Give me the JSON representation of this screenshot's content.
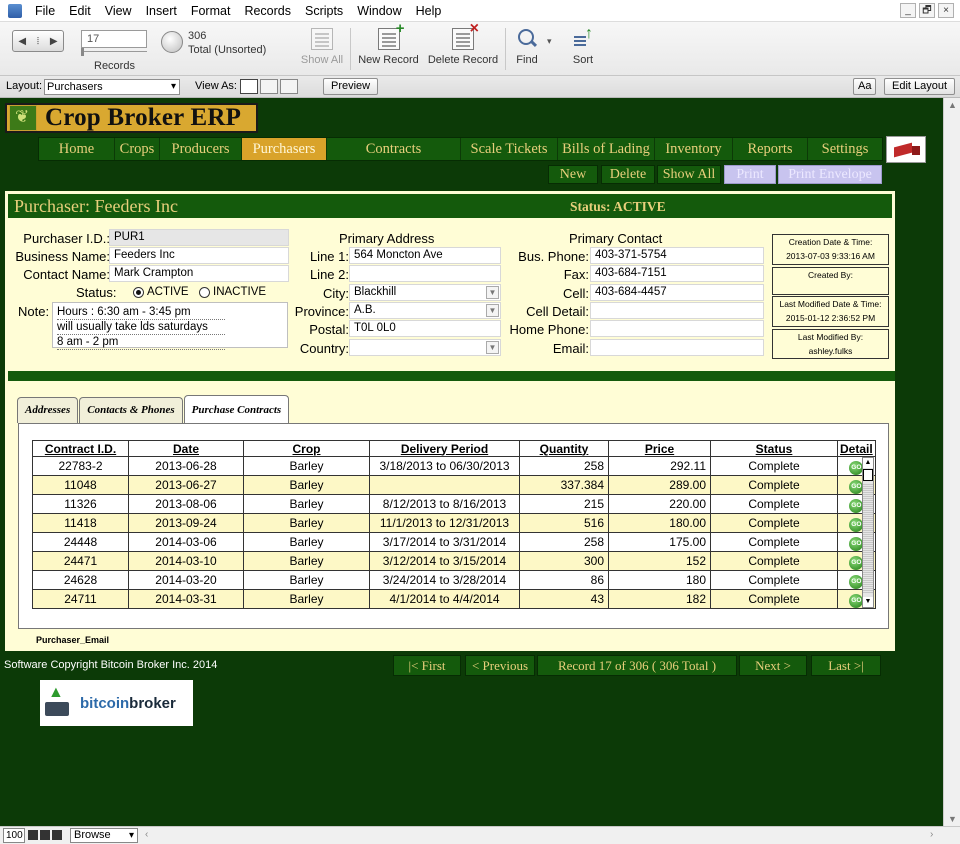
{
  "menu": [
    "File",
    "Edit",
    "View",
    "Insert",
    "Format",
    "Records",
    "Scripts",
    "Window",
    "Help"
  ],
  "window_buttons": [
    "_",
    "🗗",
    "×"
  ],
  "toolbar": {
    "record_value": "17",
    "records_label": "Records",
    "total_count": "306",
    "total_label": "Total (Unsorted)",
    "show_all": "Show All",
    "new_record": "New Record",
    "delete_record": "Delete Record",
    "find": "Find",
    "sort": "Sort"
  },
  "layoutbar": {
    "layout_label": "Layout:",
    "layout_value": "Purchasers",
    "view_as_label": "View As:",
    "preview": "Preview",
    "aa": "Aa",
    "edit_layout": "Edit Layout"
  },
  "app": {
    "title": "Crop Broker ERP"
  },
  "nav": [
    "Home",
    "Crops",
    "Producers",
    "Purchasers",
    "Contracts",
    "Scale Tickets",
    "Bills of Lading",
    "Inventory",
    "Reports",
    "Settings"
  ],
  "nav_active": "Purchasers",
  "actions": {
    "new": "New",
    "delete": "Delete",
    "show_all": "Show All",
    "print": "Print",
    "print_envelope": "Print Envelope"
  },
  "header": {
    "title": "Purchaser: Feeders Inc",
    "status": "Status: ACTIVE"
  },
  "fields": {
    "purchaser_id_label": "Purchaser I.D.:",
    "purchaser_id": "PUR1",
    "business_name_label": "Business Name:",
    "business_name": "Feeders Inc",
    "contact_name_label": "Contact Name:",
    "contact_name": "Mark Crampton",
    "status_label": "Status:",
    "status_active": "ACTIVE",
    "status_inactive": "INACTIVE",
    "note_label": "Note:",
    "note_lines": [
      "Hours : 6:30 am - 3:45 pm",
      "will usually take lds saturdays",
      "8 am - 2 pm"
    ]
  },
  "address": {
    "heading": "Primary Address",
    "line1_label": "Line 1:",
    "line1": "564 Moncton Ave",
    "line2_label": "Line 2:",
    "line2": "",
    "city_label": "City:",
    "city": "Blackhill",
    "province_label": "Province:",
    "province": "A.B.",
    "postal_label": "Postal:",
    "postal": "T0L 0L0",
    "country_label": "Country:",
    "country": ""
  },
  "contact": {
    "heading": "Primary Contact",
    "bus_phone_label": "Bus. Phone:",
    "bus_phone": "403-371-5754",
    "fax_label": "Fax:",
    "fax": "403-684-7151",
    "cell_label": "Cell:",
    "cell": "403-684-4457",
    "cell_detail_label": "Cell Detail:",
    "cell_detail": "",
    "home_phone_label": "Home Phone:",
    "home_phone": "",
    "email_label": "Email:",
    "email": ""
  },
  "meta": {
    "created_label": "Creation Date & Time:",
    "created": "2013-07-03 9:33:16 AM",
    "created_by_label": "Created By:",
    "created_by": "",
    "modified_label": "Last Modified Date & Time:",
    "modified": "2015-01-12 2:36:52 PM",
    "modified_by_label": "Last Modified By:",
    "modified_by": "ashley.fulks"
  },
  "tabs": [
    "Addresses",
    "Contacts & Phones",
    "Purchase Contracts"
  ],
  "active_tab": "Purchase Contracts",
  "contracts": {
    "headers": [
      "Contract I.D.",
      "Date",
      "Crop",
      "Delivery Period",
      "Quantity",
      "Price",
      "Status",
      "Detail"
    ],
    "go_label": "GO",
    "rows": [
      [
        "22783-2",
        "2013-06-28",
        "Barley",
        "3/18/2013 to 06/30/2013",
        "258",
        "292.11",
        "Complete"
      ],
      [
        "11048",
        "2013-06-27",
        "Barley",
        "",
        "337.384",
        "289.00",
        "Complete"
      ],
      [
        "11326",
        "2013-08-06",
        "Barley",
        "8/12/2013 to 8/16/2013",
        "215",
        "220.00",
        "Complete"
      ],
      [
        "11418",
        "2013-09-24",
        "Barley",
        "11/1/2013 to 12/31/2013",
        "516",
        "180.00",
        "Complete"
      ],
      [
        "24448",
        "2014-03-06",
        "Barley",
        "3/17/2014 to 3/31/2014",
        "258",
        "175.00",
        "Complete"
      ],
      [
        "24471",
        "2014-03-10",
        "Barley",
        "3/12/2014 to 3/15/2014",
        "300",
        "152",
        "Complete"
      ],
      [
        "24628",
        "2014-03-20",
        "Barley",
        "3/24/2014 to 3/28/2014",
        "86",
        "180",
        "Complete"
      ],
      [
        "24711",
        "2014-03-31",
        "Barley",
        "4/1/2014 to 4/4/2014",
        "43",
        "182",
        "Complete"
      ]
    ]
  },
  "email_field_label": "Purchaser_Email",
  "footer": {
    "copyright": "Software Copyright Bitcoin Broker Inc. 2014",
    "first": "|< First",
    "previous": "< Previous",
    "record_info": "Record 17 of 306 ( 306 Total )",
    "next": "Next >",
    "last": "Last >|",
    "brand_a": "bitcoin",
    "brand_b": "broker"
  },
  "statusbar": {
    "zoom": "100",
    "mode": "Browse"
  },
  "colors": {
    "bg_green": "#0c3a07",
    "nav_green": "#145a0c",
    "gold": "#d9a32a",
    "cream": "#fffdd6",
    "row_alt": "#fdf8c6"
  }
}
